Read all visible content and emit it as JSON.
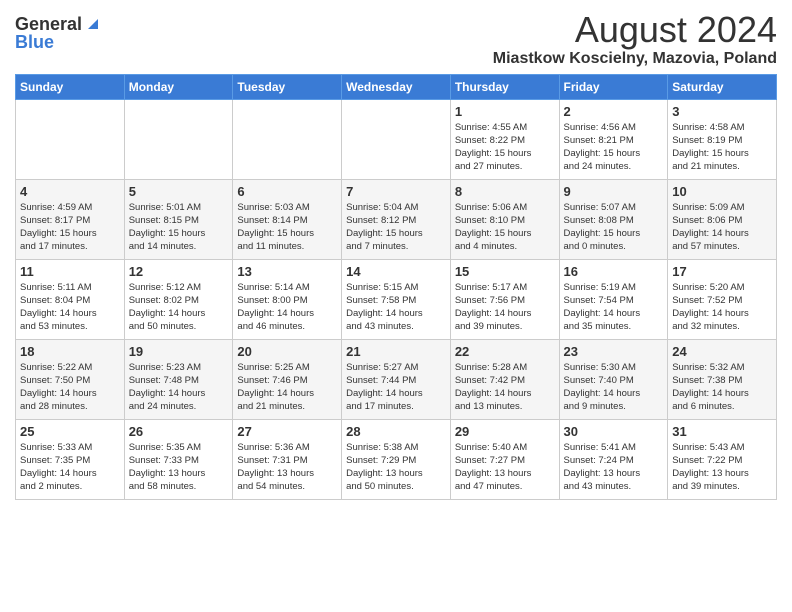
{
  "logo": {
    "general": "General",
    "blue": "Blue"
  },
  "title": {
    "month_year": "August 2024",
    "location": "Miastkow Koscielny, Mazovia, Poland"
  },
  "headers": [
    "Sunday",
    "Monday",
    "Tuesday",
    "Wednesday",
    "Thursday",
    "Friday",
    "Saturday"
  ],
  "weeks": [
    [
      {
        "day": "",
        "info": ""
      },
      {
        "day": "",
        "info": ""
      },
      {
        "day": "",
        "info": ""
      },
      {
        "day": "",
        "info": ""
      },
      {
        "day": "1",
        "info": "Sunrise: 4:55 AM\nSunset: 8:22 PM\nDaylight: 15 hours\nand 27 minutes."
      },
      {
        "day": "2",
        "info": "Sunrise: 4:56 AM\nSunset: 8:21 PM\nDaylight: 15 hours\nand 24 minutes."
      },
      {
        "day": "3",
        "info": "Sunrise: 4:58 AM\nSunset: 8:19 PM\nDaylight: 15 hours\nand 21 minutes."
      }
    ],
    [
      {
        "day": "4",
        "info": "Sunrise: 4:59 AM\nSunset: 8:17 PM\nDaylight: 15 hours\nand 17 minutes."
      },
      {
        "day": "5",
        "info": "Sunrise: 5:01 AM\nSunset: 8:15 PM\nDaylight: 15 hours\nand 14 minutes."
      },
      {
        "day": "6",
        "info": "Sunrise: 5:03 AM\nSunset: 8:14 PM\nDaylight: 15 hours\nand 11 minutes."
      },
      {
        "day": "7",
        "info": "Sunrise: 5:04 AM\nSunset: 8:12 PM\nDaylight: 15 hours\nand 7 minutes."
      },
      {
        "day": "8",
        "info": "Sunrise: 5:06 AM\nSunset: 8:10 PM\nDaylight: 15 hours\nand 4 minutes."
      },
      {
        "day": "9",
        "info": "Sunrise: 5:07 AM\nSunset: 8:08 PM\nDaylight: 15 hours\nand 0 minutes."
      },
      {
        "day": "10",
        "info": "Sunrise: 5:09 AM\nSunset: 8:06 PM\nDaylight: 14 hours\nand 57 minutes."
      }
    ],
    [
      {
        "day": "11",
        "info": "Sunrise: 5:11 AM\nSunset: 8:04 PM\nDaylight: 14 hours\nand 53 minutes."
      },
      {
        "day": "12",
        "info": "Sunrise: 5:12 AM\nSunset: 8:02 PM\nDaylight: 14 hours\nand 50 minutes."
      },
      {
        "day": "13",
        "info": "Sunrise: 5:14 AM\nSunset: 8:00 PM\nDaylight: 14 hours\nand 46 minutes."
      },
      {
        "day": "14",
        "info": "Sunrise: 5:15 AM\nSunset: 7:58 PM\nDaylight: 14 hours\nand 43 minutes."
      },
      {
        "day": "15",
        "info": "Sunrise: 5:17 AM\nSunset: 7:56 PM\nDaylight: 14 hours\nand 39 minutes."
      },
      {
        "day": "16",
        "info": "Sunrise: 5:19 AM\nSunset: 7:54 PM\nDaylight: 14 hours\nand 35 minutes."
      },
      {
        "day": "17",
        "info": "Sunrise: 5:20 AM\nSunset: 7:52 PM\nDaylight: 14 hours\nand 32 minutes."
      }
    ],
    [
      {
        "day": "18",
        "info": "Sunrise: 5:22 AM\nSunset: 7:50 PM\nDaylight: 14 hours\nand 28 minutes."
      },
      {
        "day": "19",
        "info": "Sunrise: 5:23 AM\nSunset: 7:48 PM\nDaylight: 14 hours\nand 24 minutes."
      },
      {
        "day": "20",
        "info": "Sunrise: 5:25 AM\nSunset: 7:46 PM\nDaylight: 14 hours\nand 21 minutes."
      },
      {
        "day": "21",
        "info": "Sunrise: 5:27 AM\nSunset: 7:44 PM\nDaylight: 14 hours\nand 17 minutes."
      },
      {
        "day": "22",
        "info": "Sunrise: 5:28 AM\nSunset: 7:42 PM\nDaylight: 14 hours\nand 13 minutes."
      },
      {
        "day": "23",
        "info": "Sunrise: 5:30 AM\nSunset: 7:40 PM\nDaylight: 14 hours\nand 9 minutes."
      },
      {
        "day": "24",
        "info": "Sunrise: 5:32 AM\nSunset: 7:38 PM\nDaylight: 14 hours\nand 6 minutes."
      }
    ],
    [
      {
        "day": "25",
        "info": "Sunrise: 5:33 AM\nSunset: 7:35 PM\nDaylight: 14 hours\nand 2 minutes."
      },
      {
        "day": "26",
        "info": "Sunrise: 5:35 AM\nSunset: 7:33 PM\nDaylight: 13 hours\nand 58 minutes."
      },
      {
        "day": "27",
        "info": "Sunrise: 5:36 AM\nSunset: 7:31 PM\nDaylight: 13 hours\nand 54 minutes."
      },
      {
        "day": "28",
        "info": "Sunrise: 5:38 AM\nSunset: 7:29 PM\nDaylight: 13 hours\nand 50 minutes."
      },
      {
        "day": "29",
        "info": "Sunrise: 5:40 AM\nSunset: 7:27 PM\nDaylight: 13 hours\nand 47 minutes."
      },
      {
        "day": "30",
        "info": "Sunrise: 5:41 AM\nSunset: 7:24 PM\nDaylight: 13 hours\nand 43 minutes."
      },
      {
        "day": "31",
        "info": "Sunrise: 5:43 AM\nSunset: 7:22 PM\nDaylight: 13 hours\nand 39 minutes."
      }
    ]
  ]
}
